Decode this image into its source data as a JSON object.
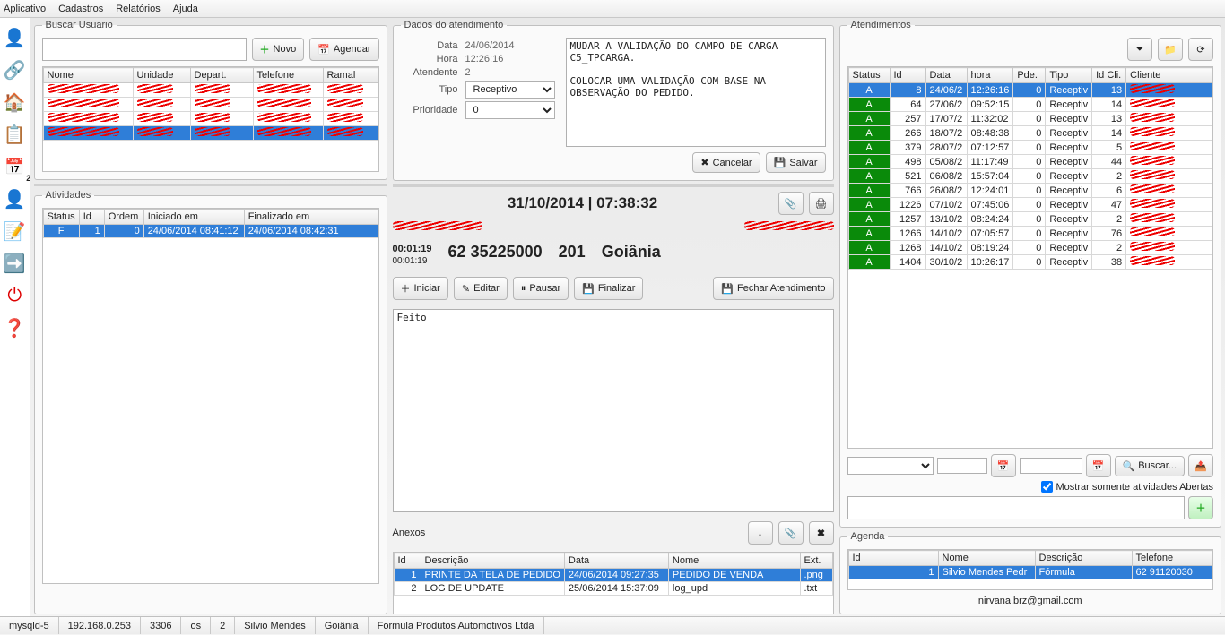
{
  "menu": {
    "aplicativo": "Aplicativo",
    "cadastros": "Cadastros",
    "relatorios": "Relatórios",
    "ajuda": "Ajuda"
  },
  "buscar": {
    "title": "Buscar Usuario",
    "novo": "Novo",
    "agendar": "Agendar",
    "cols": {
      "nome": "Nome",
      "unidade": "Unidade",
      "depart": "Depart.",
      "telefone": "Telefone",
      "ramal": "Ramal"
    }
  },
  "atividades": {
    "title": "Atividades",
    "cols": {
      "status": "Status",
      "id": "Id",
      "ordem": "Ordem",
      "iniciado": "Iniciado em",
      "finalizado": "Finalizado em"
    },
    "row": {
      "status": "F",
      "id": "1",
      "ordem": "0",
      "iniciado": "24/06/2014 08:41:12",
      "finalizado": "24/06/2014 08:42:31"
    }
  },
  "dados": {
    "title": "Dados do atendimento",
    "data_lbl": "Data",
    "data": "24/06/2014",
    "hora_lbl": "Hora",
    "hora": "12:26:16",
    "atend_lbl": "Atendente",
    "atend": "2",
    "tipo_lbl": "Tipo",
    "tipo": "Receptivo",
    "prio_lbl": "Prioridade",
    "prio": "0",
    "notes": "MUDAR A VALIDAÇÃO DO CAMPO DE CARGA C5_TPCARGA.\n\nCOLOCAR UMA VALIDAÇÃO COM BASE NA OBSERVAÇÃO DO PEDIDO.",
    "cancelar": "Cancelar",
    "salvar": "Salvar"
  },
  "ticket": {
    "datetime": "31/10/2014 | 07:38:32",
    "timer": "00:01:19",
    "timer2": "00:01:19",
    "phone": "62 35225000",
    "ext": "201",
    "city": "Goiânia",
    "btn": {
      "iniciar": "Iniciar",
      "editar": "Editar",
      "pausar": "Pausar",
      "finalizar": "Finalizar",
      "fechar": "Fechar Atendimento"
    },
    "body": "Feito"
  },
  "anexos": {
    "title": "Anexos",
    "cols": {
      "id": "Id",
      "desc": "Descrição",
      "data": "Data",
      "nome": "Nome",
      "ext": "Ext."
    },
    "rows": [
      {
        "id": "1",
        "desc": "PRINTE DA TELA DE PEDIDO",
        "data": "24/06/2014 09:27:35",
        "nome": "PEDIDO DE VENDA",
        "ext": ".png"
      },
      {
        "id": "2",
        "desc": "LOG DE UPDATE",
        "data": "25/06/2014 15:37:09",
        "nome": "log_upd",
        "ext": ".txt"
      }
    ]
  },
  "atend": {
    "title": "Atendimentos",
    "cols": {
      "status": "Status",
      "id": "Id",
      "data": "Data",
      "hora": "hora",
      "pde": "Pde.",
      "tipo": "Tipo",
      "idcli": "Id Cli.",
      "cliente": "Cliente"
    },
    "rows": [
      {
        "id": "8",
        "data": "24/06/2",
        "hora": "12:26:16",
        "pde": "0",
        "tipo": "Receptiv",
        "idcli": "13"
      },
      {
        "id": "64",
        "data": "27/06/2",
        "hora": "09:52:15",
        "pde": "0",
        "tipo": "Receptiv",
        "idcli": "14"
      },
      {
        "id": "257",
        "data": "17/07/2",
        "hora": "11:32:02",
        "pde": "0",
        "tipo": "Receptiv",
        "idcli": "13"
      },
      {
        "id": "266",
        "data": "18/07/2",
        "hora": "08:48:38",
        "pde": "0",
        "tipo": "Receptiv",
        "idcli": "14"
      },
      {
        "id": "379",
        "data": "28/07/2",
        "hora": "07:12:57",
        "pde": "0",
        "tipo": "Receptiv",
        "idcli": "5"
      },
      {
        "id": "498",
        "data": "05/08/2",
        "hora": "11:17:49",
        "pde": "0",
        "tipo": "Receptiv",
        "idcli": "44"
      },
      {
        "id": "521",
        "data": "06/08/2",
        "hora": "15:57:04",
        "pde": "0",
        "tipo": "Receptiv",
        "idcli": "2"
      },
      {
        "id": "766",
        "data": "26/08/2",
        "hora": "12:24:01",
        "pde": "0",
        "tipo": "Receptiv",
        "idcli": "6"
      },
      {
        "id": "1226",
        "data": "07/10/2",
        "hora": "07:45:06",
        "pde": "0",
        "tipo": "Receptiv",
        "idcli": "47"
      },
      {
        "id": "1257",
        "data": "13/10/2",
        "hora": "08:24:24",
        "pde": "0",
        "tipo": "Receptiv",
        "idcli": "2"
      },
      {
        "id": "1266",
        "data": "14/10/2",
        "hora": "07:05:57",
        "pde": "0",
        "tipo": "Receptiv",
        "idcli": "76"
      },
      {
        "id": "1268",
        "data": "14/10/2",
        "hora": "08:19:24",
        "pde": "0",
        "tipo": "Receptiv",
        "idcli": "2"
      },
      {
        "id": "1404",
        "data": "30/10/2",
        "hora": "10:26:17",
        "pde": "0",
        "tipo": "Receptiv",
        "idcli": "38"
      }
    ],
    "buscar": "Buscar...",
    "mostrar": "Mostrar somente atividades Abertas"
  },
  "agenda": {
    "title": "Agenda",
    "cols": {
      "id": "Id",
      "nome": "Nome",
      "desc": "Descrição",
      "tel": "Telefone"
    },
    "row": {
      "id": "1",
      "nome": "Silvio Mendes Pedr",
      "desc": "Fórmula",
      "tel": "62 91120030"
    },
    "email": "nirvana.brz@gmail.com"
  },
  "status": {
    "db": "mysqld-5",
    "ip": "192.168.0.253",
    "port": "3306",
    "os": "os",
    "n": "2",
    "user": "Silvio Mendes",
    "city": "Goiânia",
    "company": "Formula Produtos Automotivos Ltda"
  }
}
